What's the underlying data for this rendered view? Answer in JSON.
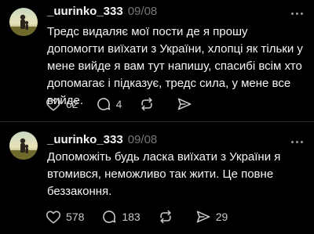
{
  "posts": [
    {
      "username": "_uurinko_333",
      "date": "09/08",
      "text": "Тредс видаляє мої пости де я прошу допомогти виїхати з України, хлопці як тільки у мене вийде я вам тут напишу, спасибі всім хто допомагає і підказує, тредс сила, у мене все вийде.",
      "likes": "62",
      "replies": "4",
      "reposts": "",
      "shares": ""
    },
    {
      "username": "_uurinko_333",
      "date": "09/08",
      "text": "Допоможіть будь ласка виїхати з України я втомився, неможливо так жити. Це повне беззаконня.",
      "likes": "578",
      "replies": "183",
      "reposts": "",
      "shares": "29"
    }
  ],
  "icons": {
    "like": "heart-icon",
    "reply": "comment-icon",
    "repost": "repost-icon",
    "share": "share-icon",
    "more": "more-icon"
  },
  "colors": {
    "background": "#000000",
    "text": "#f3f5f7",
    "muted": "#777777",
    "icon": "#c9c9c9",
    "divider": "#2b2b2b"
  }
}
